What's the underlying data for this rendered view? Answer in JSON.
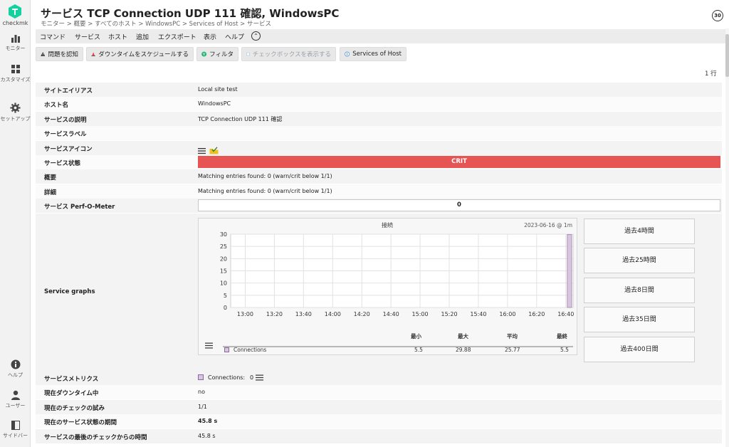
{
  "sidebar": {
    "logo_text": "checkmk",
    "items": [
      {
        "label": "モニター",
        "icon": "bar-chart-icon"
      },
      {
        "label": "カスタマイズ",
        "icon": "grid-icon"
      },
      {
        "label": "セットアップ",
        "icon": "gear-icon"
      },
      {
        "label": "ヘルプ",
        "icon": "info-icon"
      },
      {
        "label": "ユーザー",
        "icon": "user-icon"
      },
      {
        "label": "サイドバー",
        "icon": "sidebar-icon"
      }
    ]
  },
  "header": {
    "title": "サービス TCP Connection UDP 111 確認, WindowsPC",
    "breadcrumb": "モニター > 概要 > すべてのホスト > WindowsPC > Services of Host > サービス",
    "refresh": "30"
  },
  "menu": {
    "items": [
      "コマンド",
      "サービス",
      "ホスト",
      "追加",
      "エクスポート",
      "表示",
      "ヘルプ"
    ],
    "toggle": "⌃"
  },
  "toolbar": {
    "ack": "問題を認知",
    "downtime": "ダウンタイムをスケジュールする",
    "filter": "フィルタ",
    "checkbox": "チェックボックスを表示する",
    "services": "Services of Host"
  },
  "row_count": "1 行",
  "rows": {
    "site_alias": {
      "key": "サイトエイリアス",
      "value": "Local site test"
    },
    "host_name": {
      "key": "ホスト名",
      "value": "WindowsPC"
    },
    "service_desc": {
      "key": "サービスの説明",
      "value": "TCP Connection UDP 111 確認"
    },
    "service_labels": {
      "key": "サービスラベル",
      "value": ""
    },
    "service_icons": {
      "key": "サービスアイコン"
    },
    "service_state": {
      "key": "サービス状態",
      "value": "CRIT"
    },
    "summary": {
      "key": "概要",
      "value": "Matching entries found: 0 (warn/crit below 1/1)"
    },
    "details": {
      "key": "詳細",
      "value": "Matching entries found: 0 (warn/crit below 1/1)"
    },
    "perf_o_meter": {
      "key": "サービス Perf-O-Meter",
      "value": "0"
    },
    "service_graphs": {
      "key": "Service graphs"
    },
    "metrics": {
      "key": "サービスメトリクス",
      "label": "Connections:",
      "value": "0"
    },
    "in_downtime": {
      "key": "現在ダウンタイム中",
      "value": "no"
    },
    "check_attempt": {
      "key": "現在のチェックの試み",
      "value": "1/1"
    },
    "state_duration": {
      "key": "現在のサービス状態の期間",
      "value": "45.8 s"
    },
    "last_check": {
      "key": "サービスの最後のチェックからの時間",
      "value": "45.8 s"
    }
  },
  "timeframes": [
    "過去4時間",
    "過去25時間",
    "過去8日間",
    "過去35日間",
    "過去400日間"
  ],
  "colors": {
    "crit": "#e65454",
    "ok_text": "#13a04a",
    "series": "#d8c6e0",
    "logo": "#15d1a0"
  },
  "chart_data": {
    "type": "area",
    "title": "接続",
    "timestamp": "2023-06-16 @ 1m",
    "x_ticks": [
      "13:00",
      "13:20",
      "13:40",
      "14:00",
      "14:20",
      "14:40",
      "15:00",
      "15:20",
      "15:40",
      "16:00",
      "16:20",
      "16:40"
    ],
    "y_ticks": [
      0,
      5,
      10,
      15,
      20,
      25,
      30
    ],
    "ylim": [
      0,
      30
    ],
    "grid": true,
    "series": [
      {
        "name": "Connections",
        "color": "#d8c6e0",
        "x": [
          "16:41",
          "16:44"
        ],
        "y": [
          29.88,
          29.88
        ]
      }
    ],
    "legend": {
      "headers": [
        "最小",
        "最大",
        "平均",
        "最終"
      ],
      "rows": [
        {
          "name": "Connections",
          "min": "5.5",
          "max": "29.88",
          "avg": "25.77",
          "last": "5.5"
        }
      ]
    }
  }
}
